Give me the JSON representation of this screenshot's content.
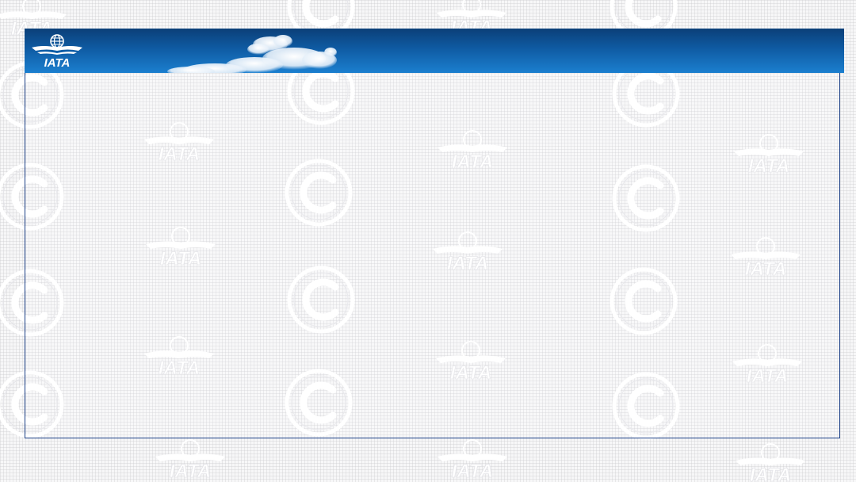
{
  "header": {
    "logo_text": "IATA",
    "logo_icon": "iata-globe-wings-icon"
  },
  "watermark": {
    "logo_text": "IATA",
    "logo_icon": "iata-globe-wings-icon",
    "copyright_icon": "copyright-icon"
  },
  "colors": {
    "header_dark": "#0b3f78",
    "header_light": "#1b7fcf",
    "frame_border": "#1b3f86",
    "background": "#f7f7f8"
  }
}
